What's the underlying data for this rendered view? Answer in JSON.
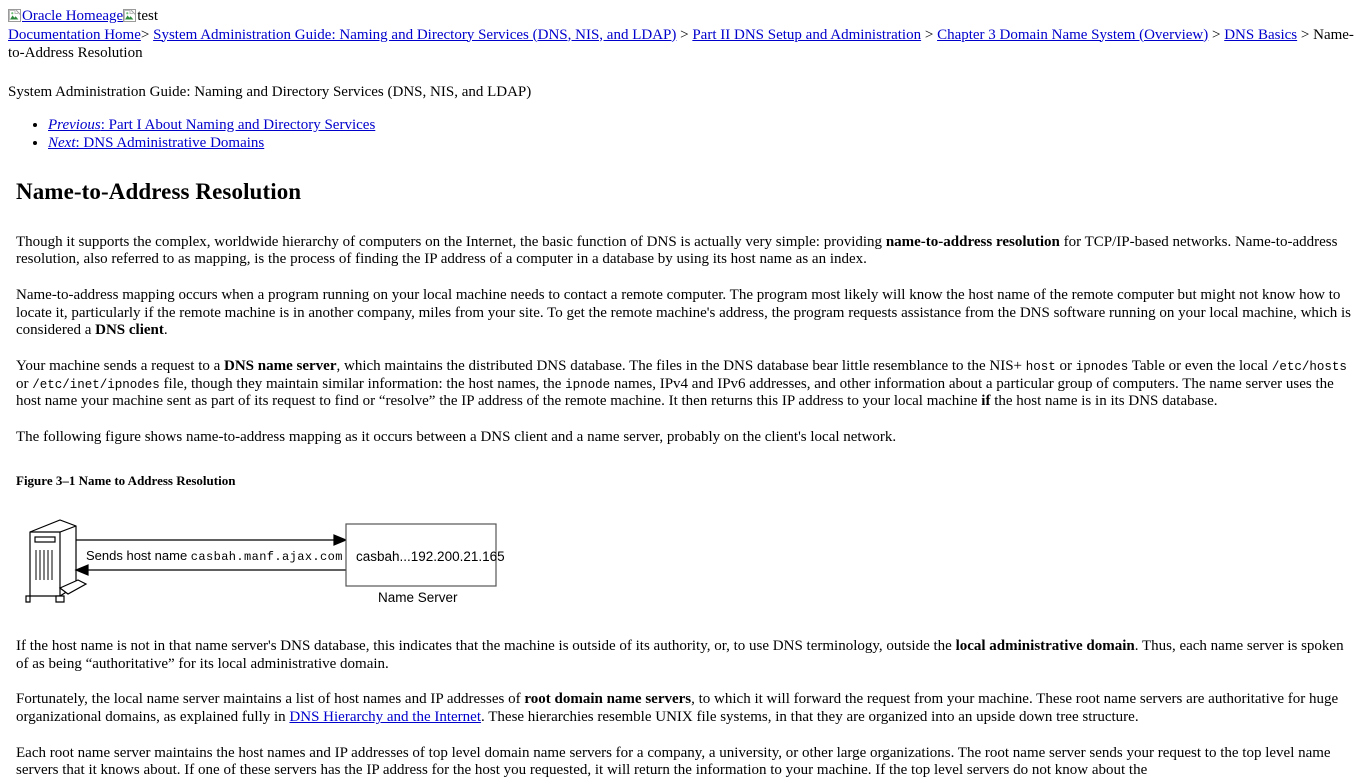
{
  "header": {
    "home_image_alt": "Oracle Homeage",
    "home_image_icon": "broken-image-icon",
    "secondary_image_alt": "test",
    "secondary_image_icon": "broken-image-icon"
  },
  "breadcrumb": {
    "separator": ">",
    "items": [
      {
        "label": "Documentation Home",
        "is_link": true
      },
      {
        "label": "System Administration Guide: Naming and Directory Services (DNS, NIS, and LDAP)",
        "is_link": true
      },
      {
        "label": "Part II DNS Setup and Administration",
        "is_link": true
      },
      {
        "label": "Chapter 3 Domain Name System (Overview)",
        "is_link": true
      },
      {
        "label": "DNS Basics",
        "is_link": true
      },
      {
        "label": "Name-to-Address Resolution",
        "is_link": false
      }
    ]
  },
  "book_title": "System Administration Guide: Naming and Directory Services (DNS, NIS, and LDAP)",
  "nav": {
    "previous_label": "Previous",
    "previous_text": ": Part I About Naming and Directory Services",
    "next_label": "Next",
    "next_text": ": DNS Administrative Domains"
  },
  "page_title": "Name-to-Address Resolution",
  "paragraphs": {
    "p1_a": "Though it supports the complex, worldwide hierarchy of computers on the Internet, the basic function of DNS is actually very simple: providing ",
    "p1_bold": "name-to-address resolution",
    "p1_b": " for TCP/IP-based networks. Name-to-address resolution, also referred to as mapping, is the process of finding the IP address of a computer in a database by using its host name as an index.",
    "p2_a": "Name-to-address mapping occurs when a program running on your local machine needs to contact a remote computer. The program most likely will know the host name of the remote computer but might not know how to locate it, particularly if the remote machine is in another company, miles from your site. To get the remote machine's address, the program requests assistance from the DNS software running on your local machine, which is considered a ",
    "p2_bold": "DNS client",
    "p2_b": ".",
    "p3_a": "Your machine sends a request to a ",
    "p3_bold1": "DNS name server",
    "p3_b": ", which maintains the distributed DNS database. The files in the DNS database bear little resemblance to the NIS+ ",
    "p3_code1": "host",
    "p3_c": " or ",
    "p3_code2": "ipnodes",
    "p3_d": " Table or even the local ",
    "p3_code3": "/etc/hosts",
    "p3_e": " or ",
    "p3_code4": "/etc/inet/ipnodes",
    "p3_f": " file, though they maintain similar information: the host names, the ",
    "p3_code5": "ipnode",
    "p3_g": " names, IPv4 and IPv6 addresses, and other information about a particular group of computers. The name server uses the host name your machine sent as part of its request to find or “resolve” the IP address of the remote machine. It then returns this IP address to your local machine ",
    "p3_bold2": "if",
    "p3_h": " the host name is in its DNS database.",
    "p4": "The following figure shows name-to-address mapping as it occurs between a DNS client and a name server, probably on the client's local network.",
    "p5_a": "If the host name is not in that name server's DNS database, this indicates that the machine is outside of its authority, or, to use DNS terminology, outside the ",
    "p5_bold": "local administrative domain",
    "p5_b": ". Thus, each name server is spoken of as being “authoritative” for its local administrative domain.",
    "p6_a": "Fortunately, the local name server maintains a list of host names and IP addresses of ",
    "p6_bold": "root domain name servers",
    "p6_b": ", to which it will forward the request from your machine. These root name servers are authoritative for huge organizational domains, as explained fully in ",
    "p6_link": "DNS Hierarchy and the Internet",
    "p6_c": ". These hierarchies resemble UNIX file systems, in that they are organized into an upside down tree structure.",
    "p7": "Each root name server maintains the host names and IP addresses of top level domain name servers for a company, a university, or other large organizations. The root name server sends your request to the top level name servers that it knows about. If one of these servers has the IP address for the host you requested, it will return the information to your machine. If the top level servers do not know about the"
  },
  "figure": {
    "caption": "Figure 3–1 Name to Address Resolution",
    "client_icon": "computer-tower-icon",
    "request_label": "Sends host name ",
    "request_hostname": "casbah.manf.ajax.com",
    "server_record": "casbah...192.200.21.165",
    "server_label": "Name Server"
  },
  "colors": {
    "link": "#0000cc",
    "text": "#000000",
    "background": "#ffffff",
    "figure_stroke": "#000000"
  }
}
